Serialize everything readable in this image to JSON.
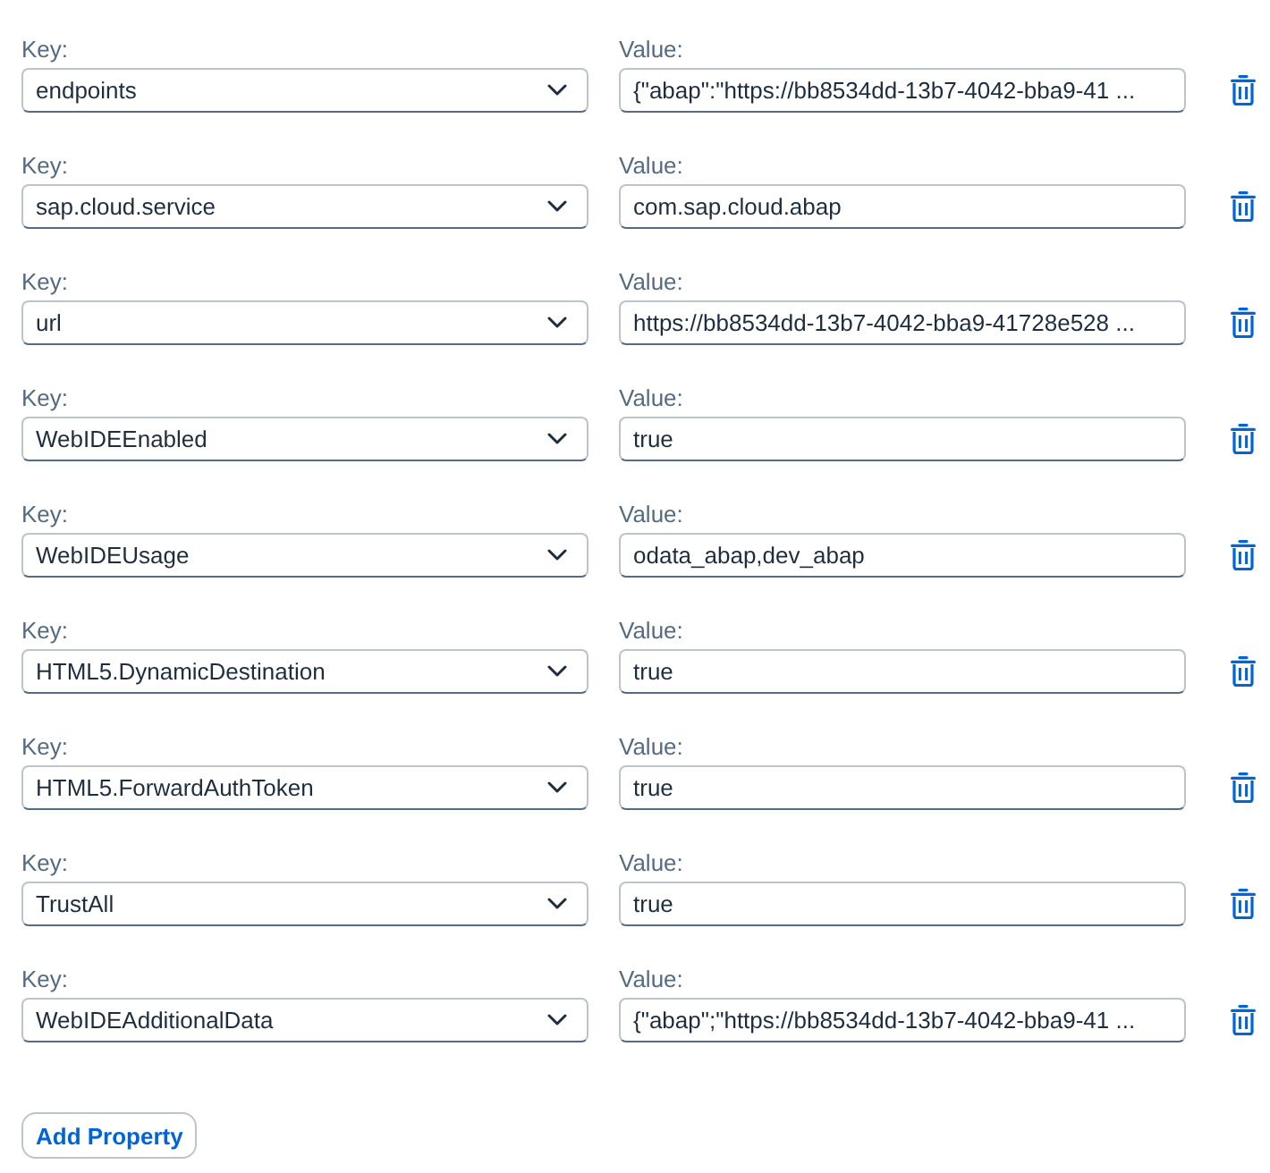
{
  "properties": [
    {
      "key_label": "Key:",
      "key": "endpoints",
      "value_label": "Value:",
      "value": "{\"abap\":\"https://bb8534dd-13b7-4042-bba9-41 ..."
    },
    {
      "key_label": "Key:",
      "key": "sap.cloud.service",
      "value_label": "Value:",
      "value": "com.sap.cloud.abap"
    },
    {
      "key_label": "Key:",
      "key": "url",
      "value_label": "Value:",
      "value": "https://bb8534dd-13b7-4042-bba9-41728e528 ..."
    },
    {
      "key_label": "Key:",
      "key": "WebIDEEnabled",
      "value_label": "Value:",
      "value": "true"
    },
    {
      "key_label": "Key:",
      "key": "WebIDEUsage",
      "value_label": "Value:",
      "value": "odata_abap,dev_abap"
    },
    {
      "key_label": "Key:",
      "key": "HTML5.DynamicDestination",
      "value_label": "Value:",
      "value": "true"
    },
    {
      "key_label": "Key:",
      "key": "HTML5.ForwardAuthToken",
      "value_label": "Value:",
      "value": "true"
    },
    {
      "key_label": "Key:",
      "key": "TrustAll",
      "value_label": "Value:",
      "value": "true"
    },
    {
      "key_label": "Key:",
      "key": "WebIDEAdditionalData",
      "value_label": "Value:",
      "value": "{\"abap\";\"https://bb8534dd-13b7-4042-bba9-41 ..."
    }
  ],
  "add_button": "Add Property"
}
